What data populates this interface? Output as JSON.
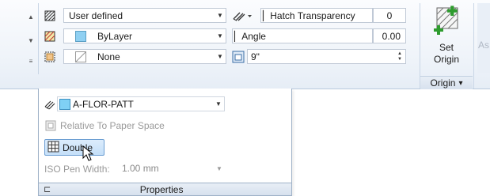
{
  "ribbon": {
    "row1": {
      "hatch_type": "User defined",
      "transparency_label": "Hatch Transparency",
      "transparency_value": "0"
    },
    "row2": {
      "color": "ByLayer",
      "angle_label": "Angle",
      "angle_value": "0.00"
    },
    "row3": {
      "background": "None",
      "spacing_value": "9\""
    },
    "origin": {
      "button_label_line1": "Set",
      "button_label_line2": "Origin",
      "panel_label": "Origin",
      "panel_arrow": "▾"
    },
    "cut_text": "As"
  },
  "panel": {
    "layer_value": "A-FLOR-PATT",
    "relative_label": "Relative To Paper Space",
    "double_label": "Double",
    "iso_label": "ISO Pen Width:",
    "iso_value": "1.00 mm",
    "title": "Properties"
  },
  "colors": {
    "bylayer_swatch": "#8fd0f2",
    "layer_swatch": "#7fd0f5",
    "accent_green": "#2e9c2e",
    "panel_border": "#9fb2c8"
  }
}
